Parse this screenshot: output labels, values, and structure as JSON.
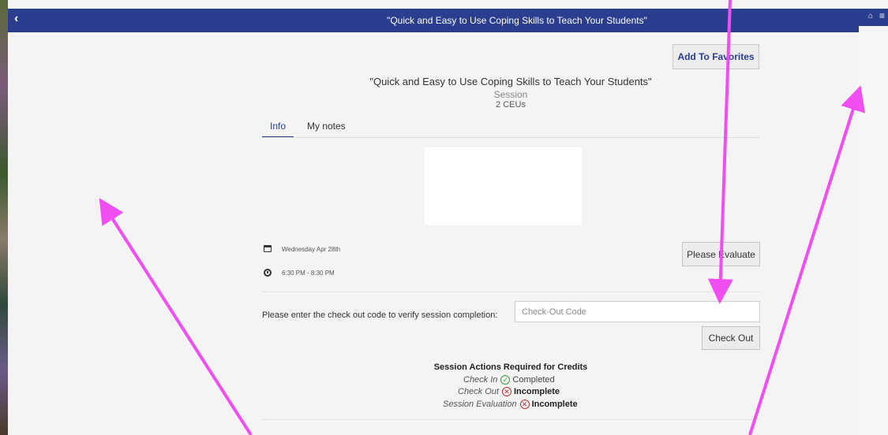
{
  "header": {
    "back_icon": "chevron-left-icon",
    "title": "\"Quick and Easy to Use Coping Skills to Teach Your Students\"",
    "home_icon": "home-icon",
    "menu_icon": "hamburger-icon",
    "bar_color": "#2a3d8f"
  },
  "session": {
    "favorites_label": "Add To Favorites",
    "title": "\"Quick and Easy to Use Coping Skills to Teach Your Students\"",
    "type": "Session",
    "ceus": "2 CEUs"
  },
  "tabs": [
    {
      "label": "Info",
      "active": true
    },
    {
      "label": "My notes",
      "active": false
    }
  ],
  "schedule": {
    "date": "Wednesday Apr 28th",
    "time": "6:30 PM - 8:30 PM",
    "date_icon": "calendar-icon",
    "time_icon": "clock-icon"
  },
  "evaluate_label": "Please Evaluate",
  "checkout": {
    "prompt": "Please enter the check out code to verify session completion:",
    "placeholder": "Check-Out Code",
    "button_label": "Check Out"
  },
  "actions": {
    "title": "Session Actions Required for Credits",
    "items": [
      {
        "label": "Check In",
        "status": "Completed",
        "ok": true
      },
      {
        "label": "Check Out",
        "status": "Incomplete",
        "ok": false
      },
      {
        "label": "Session Evaluation",
        "status": "Incomplete",
        "ok": false
      }
    ]
  },
  "annotation_color": "#f04ef0"
}
